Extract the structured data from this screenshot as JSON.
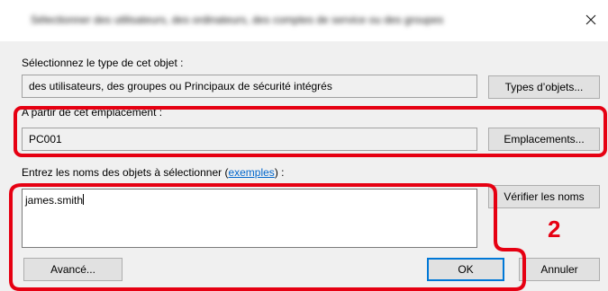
{
  "title": "Sélectionner des utilisateurs, des ordinateurs, des comptes de service ou des groupes",
  "object_type": {
    "label": "Sélectionnez le type de cet objet :",
    "value": "des utilisateurs, des groupes ou Principaux de sécurité intégrés",
    "button": "Types d’objets..."
  },
  "location": {
    "label": "A partir de cet emplacement :",
    "value": "PC001",
    "button": "Emplacements..."
  },
  "names": {
    "label_prefix": "Entrez les noms des objets à sélectionner (",
    "link": "exemples",
    "label_suffix": ") :",
    "value": "james.smith",
    "check_button": "Vérifier les noms"
  },
  "footer": {
    "advanced": "Avancé...",
    "ok": "OK",
    "cancel": "Annuler"
  },
  "annotation": {
    "callout": "2",
    "color": "#e60012"
  }
}
